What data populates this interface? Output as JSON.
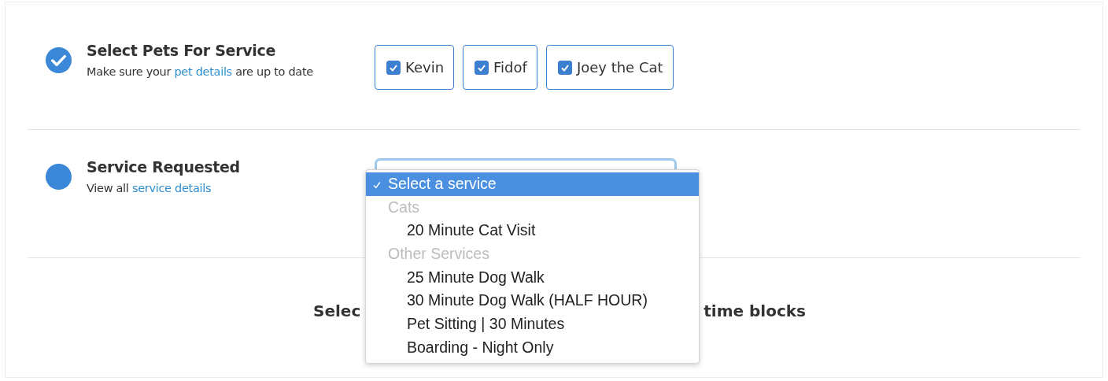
{
  "steps": [
    {
      "title": "Select Pets For Service",
      "completed": true,
      "subtitle_before": "Make sure your ",
      "link": "pet details",
      "subtitle_after": " are up to date"
    },
    {
      "title": "Service Requested",
      "completed": false,
      "subtitle_before": "View all ",
      "link": "service details"
    }
  ],
  "pets": [
    {
      "label": "Kevin",
      "checked": true
    },
    {
      "label": "Fidof",
      "checked": true
    },
    {
      "label": "Joey the Cat",
      "checked": true
    }
  ],
  "service_menu": {
    "options": [
      {
        "kind": "option",
        "label": "Select a service",
        "selected": true
      },
      {
        "kind": "group",
        "label": "Cats"
      },
      {
        "kind": "option",
        "label": "20 Minute Cat Visit",
        "selected": false
      },
      {
        "kind": "group",
        "label": "Other Services"
      },
      {
        "kind": "option",
        "label": "25 Minute Dog Walk",
        "selected": false
      },
      {
        "kind": "option",
        "label": "30 Minute Dog Walk (HALF HOUR)",
        "selected": false
      },
      {
        "kind": "option",
        "label": "Pet Sitting | 30 Minutes",
        "selected": false
      },
      {
        "kind": "option",
        "label": "Boarding - Night Only",
        "selected": false
      }
    ]
  },
  "time_heading": {
    "left": "Selec",
    "right": "time blocks"
  }
}
